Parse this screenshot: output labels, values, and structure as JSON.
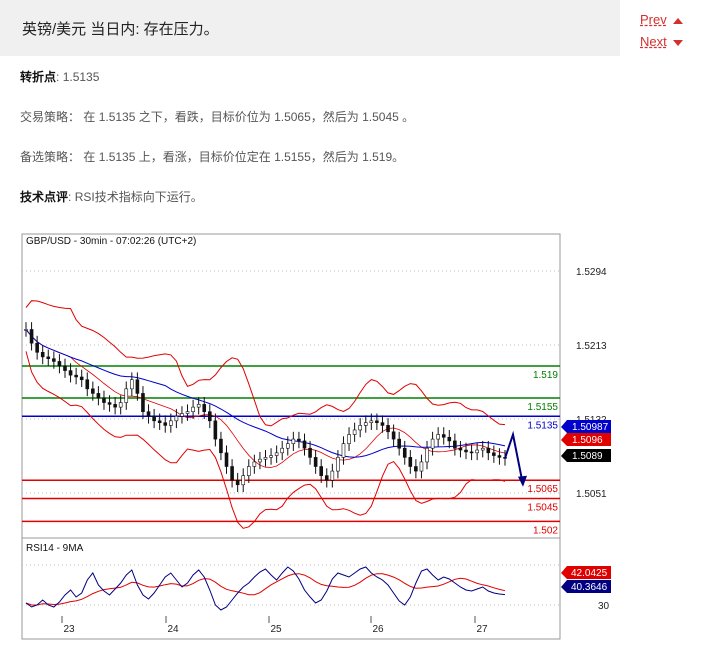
{
  "header": {
    "title": "英镑/美元 当日内: 存在压力。"
  },
  "nav": {
    "prev": "Prev",
    "next": "Next"
  },
  "pivot": {
    "label": "转折点",
    "sep": ": ",
    "value": "1.5135"
  },
  "strategy": {
    "label": "交易策略",
    "sep": "： ",
    "text": "在 1.5135 之下，看跌，目标价位为 1.5065，然后为 1.5045 。"
  },
  "alternative": {
    "label": "备选策略",
    "sep": "： ",
    "text": "在 1.5135 上，看涨，目标价位定在 1.5155，然后为 1.519。"
  },
  "comment": {
    "label": "技术点评",
    "sep": ": ",
    "text": "RSI技术指标向下运行。"
  },
  "colors": {
    "support": "#e00000",
    "resistance": "#008000",
    "pivot": "#0000cc",
    "price_tag": "#000000",
    "rsi_line": "#000080",
    "rsi_ma": "#e00000"
  },
  "chart_data": {
    "type": "line",
    "title": "GBP/USD - 30min - 07:02:26 (UTC+2)",
    "xlabel": "",
    "ylabel": "",
    "x_ticks": [
      "23",
      "24",
      "25",
      "26",
      "27"
    ],
    "y_ticks": [
      "1.5294",
      "1.5213",
      "1.5132",
      "1.5051"
    ],
    "ylim": [
      1.5,
      1.533
    ],
    "levels": [
      {
        "label": "1.519",
        "value": 1.519,
        "color": "#008000"
      },
      {
        "label": "1.5155",
        "value": 1.5155,
        "color": "#008000"
      },
      {
        "label": "1.5135",
        "value": 1.5135,
        "color": "#0000cc"
      },
      {
        "label": "1.5065",
        "value": 1.5065,
        "color": "#e00000"
      },
      {
        "label": "1.5045",
        "value": 1.5045,
        "color": "#e00000"
      },
      {
        "label": "1.502",
        "value": 1.502,
        "color": "#e00000"
      }
    ],
    "tags": [
      {
        "label": "1.50987",
        "value": 1.50987,
        "color": "#0000cc"
      },
      {
        "label": "1.5096",
        "value": 1.5096,
        "color": "#e00000"
      },
      {
        "label": "1.5089",
        "value": 1.5089,
        "color": "#000000"
      }
    ],
    "price_series": [
      1.523,
      1.5215,
      1.5205,
      1.52,
      1.5198,
      1.5195,
      1.519,
      1.5185,
      1.518,
      1.5178,
      1.5175,
      1.5165,
      1.516,
      1.5155,
      1.515,
      1.5148,
      1.5145,
      1.515,
      1.5165,
      1.5175,
      1.516,
      1.514,
      1.5135,
      1.513,
      1.5128,
      1.5125,
      1.513,
      1.5135,
      1.5138,
      1.514,
      1.5145,
      1.5148,
      1.514,
      1.513,
      1.511,
      1.5095,
      1.508,
      1.5065,
      1.506,
      1.507,
      1.508,
      1.5085,
      1.5088,
      1.509,
      1.5092,
      1.5095,
      1.51,
      1.5105,
      1.511,
      1.5108,
      1.51,
      1.509,
      1.508,
      1.507,
      1.5065,
      1.5075,
      1.509,
      1.5105,
      1.5115,
      1.512,
      1.5125,
      1.5128,
      1.513,
      1.5128,
      1.5125,
      1.5118,
      1.511,
      1.51,
      1.509,
      1.508,
      1.5075,
      1.5085,
      1.51,
      1.511,
      1.5115,
      1.5112,
      1.5108,
      1.51,
      1.5098,
      1.5096,
      1.5095,
      1.5098,
      1.51,
      1.5095,
      1.5092,
      1.509,
      1.5089
    ],
    "forecast": [
      1.5089,
      1.5115,
      1.506
    ],
    "rsi": {
      "title": "RSI14 - 9MA",
      "y_ticks": [
        "30"
      ],
      "tags": [
        {
          "label": "42.0425",
          "value": 42.0425,
          "color": "#e00000"
        },
        {
          "label": "40.3646",
          "value": 40.3646,
          "color": "#000080"
        }
      ],
      "series": [
        32,
        28,
        30,
        35,
        30,
        28,
        33,
        40,
        45,
        38,
        42,
        55,
        62,
        50,
        44,
        40,
        46,
        52,
        60,
        65,
        50,
        40,
        36,
        42,
        50,
        58,
        62,
        55,
        48,
        52,
        60,
        65,
        58,
        45,
        30,
        25,
        28,
        35,
        42,
        48,
        52,
        58,
        63,
        66,
        60,
        55,
        62,
        68,
        64,
        56,
        45,
        38,
        32,
        35,
        44,
        56,
        62,
        60,
        58,
        62,
        66,
        68,
        62,
        58,
        55,
        50,
        42,
        34,
        30,
        38,
        52,
        64,
        66,
        60,
        55,
        58,
        56,
        52,
        48,
        45,
        44,
        46,
        48,
        44,
        42,
        41,
        40.36
      ]
    }
  }
}
